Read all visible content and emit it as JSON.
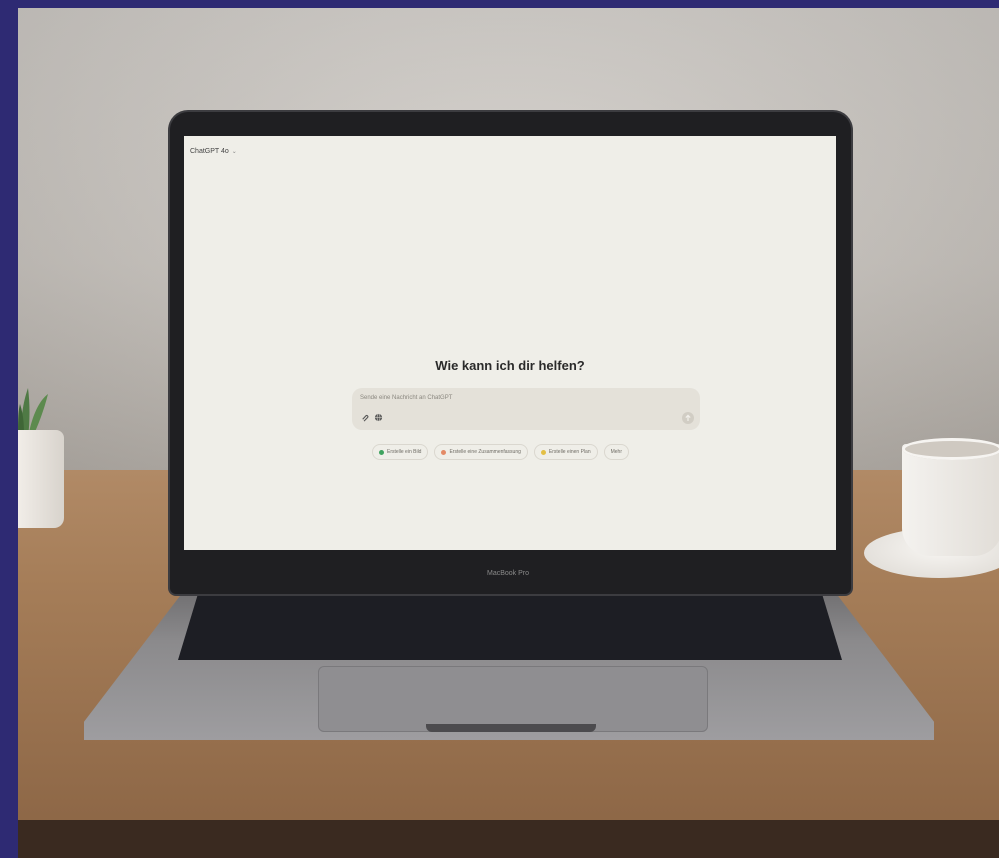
{
  "screen": {
    "model_selector": "ChatGPT 4o",
    "headline": "Wie kann ich dir helfen?",
    "composer": {
      "placeholder": "Sende eine Nachricht an ChatGPT"
    },
    "suggestions": [
      {
        "label": "Erstelle ein Bild",
        "color": "#3fa35f",
        "icon": "image-icon"
      },
      {
        "label": "Erstelle eine Zusammenfassung",
        "color": "#e38a66",
        "icon": "summary-icon"
      },
      {
        "label": "Erstelle einen Plan",
        "color": "#e3bf45",
        "icon": "lightbulb-icon"
      },
      {
        "label": "Mehr"
      }
    ]
  },
  "laptop": {
    "brand_label": "MacBook Pro"
  }
}
